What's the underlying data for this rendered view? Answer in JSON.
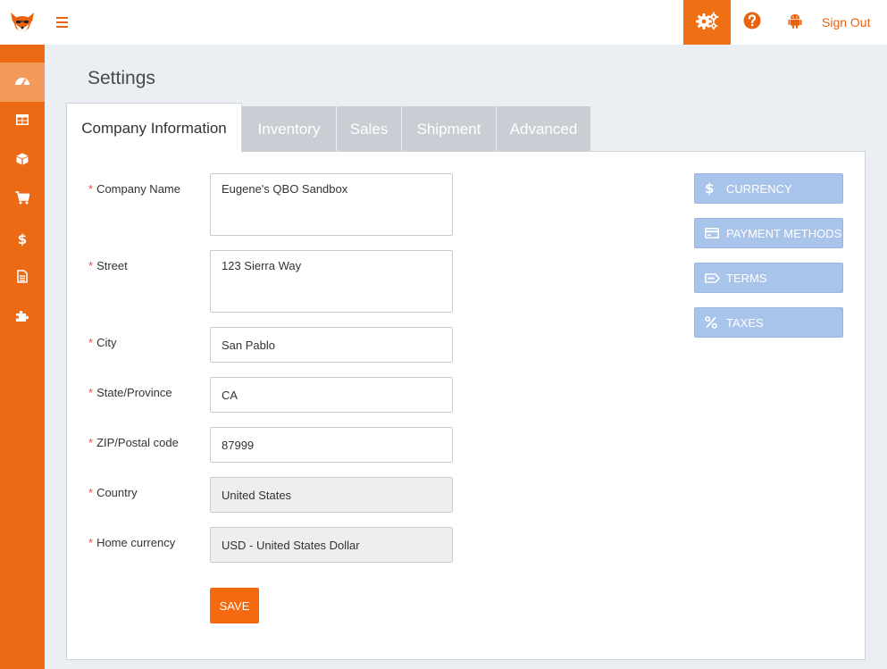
{
  "topbar": {
    "logo_icon": "fox-logo-icon",
    "menu_icon": "hamburger-icon",
    "settings_icon": "gears-icon",
    "help_icon": "question-circle-icon",
    "android_icon": "android-icon",
    "signout_label": "Sign Out",
    "accent_color": "#f07016"
  },
  "sidebar": {
    "items": [
      {
        "icon": "dashboard-icon",
        "active": true
      },
      {
        "icon": "table-icon",
        "active": false
      },
      {
        "icon": "cube-icon",
        "active": false
      },
      {
        "icon": "cart-icon",
        "active": false
      },
      {
        "icon": "dollar-icon",
        "active": false
      },
      {
        "icon": "document-icon",
        "active": false
      },
      {
        "icon": "puzzle-icon",
        "active": false
      }
    ]
  },
  "page": {
    "title": "Settings",
    "tabs": [
      {
        "label": "Company Information",
        "active": true
      },
      {
        "label": "Inventory",
        "active": false
      },
      {
        "label": "Sales",
        "active": false
      },
      {
        "label": "Shipment",
        "active": false
      },
      {
        "label": "Advanced",
        "active": false
      }
    ]
  },
  "form": {
    "required_mark": "*",
    "fields": [
      {
        "label": "Company Name",
        "value": "Eugene's QBO Sandbox"
      },
      {
        "label": "Street",
        "value": "123 Sierra Way"
      },
      {
        "label": "City",
        "value": "San Pablo"
      },
      {
        "label": "State/Province",
        "value": "CA"
      },
      {
        "label": "ZIP/Postal code",
        "value": "87999"
      },
      {
        "label": "Country",
        "value": "United States"
      },
      {
        "label": "Home currency",
        "value": "USD - United States Dollar"
      }
    ],
    "save_label": "SAVE"
  },
  "side_buttons": [
    {
      "label": "CURRENCY",
      "icon": "dollar-icon"
    },
    {
      "label": "PAYMENT METHODS",
      "icon": "credit-card-icon"
    },
    {
      "label": "TERMS",
      "icon": "tag-icon"
    },
    {
      "label": "TAXES",
      "icon": "percent-icon"
    }
  ]
}
